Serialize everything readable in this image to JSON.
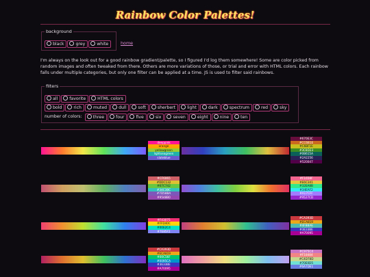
{
  "title": "Rainbow Color Palettes!",
  "background": {
    "legend": "background",
    "options": [
      "black",
      "grey",
      "white"
    ]
  },
  "home_link": "home",
  "intro": "I'm always on the look out for a good rainbow gradient/palette, so I figured I'd log them somewhere! Some are color picked from random images and often tweaked from there. Others are more variations of those, or trial and error with HTML colors. Each rainbow falls under multiple categories, but only one filter can be applied at a time. JS is used to filter said rainbows.",
  "filters": {
    "legend": "filters",
    "row1": [
      "all",
      "favorite",
      "HTML colors"
    ],
    "row2": [
      "bold",
      "rich",
      "muted",
      "dull",
      "soft",
      "sherbert",
      "light",
      "dark",
      "spectrum",
      "red",
      "sky"
    ],
    "num_label": "number of colors:",
    "row3": [
      "three",
      "four",
      "five",
      "six",
      "seven",
      "eight",
      "nine",
      "ten"
    ]
  },
  "palettes": [
    {
      "left_colors": [
        "#ff1493",
        "#ff7a2e",
        "#f2e84a",
        "#5fe35a",
        "#3fa9f5",
        "#7b5cff"
      ],
      "right_colors": [
        "#6b2fa0",
        "#3040c0",
        "#2aa0c0",
        "#40c060",
        "#e0c040",
        "#c02830"
      ],
      "mid": [
        {
          "label": "deeppink",
          "color": "#ff1493"
        },
        {
          "label": "orange",
          "color": "#ffa500",
          "dark": true
        },
        {
          "label": "yellowgreen",
          "color": "#9acd32",
          "dark": true
        },
        {
          "label": "lightseagreen",
          "color": "#20b2aa"
        },
        {
          "label": "slateblue",
          "color": "#6a5acd"
        }
      ],
      "right": [
        {
          "label": "#670E3C",
          "color": "#670e3c"
        },
        {
          "label": "#CC6B1E",
          "color": "#cc6b1e"
        },
        {
          "label": "#C6BF1E",
          "color": "#c6bf1e",
          "dark": true
        },
        {
          "label": "#3C8D23",
          "color": "#3c8d23"
        },
        {
          "label": "#0B615A",
          "color": "#0b615a"
        },
        {
          "label": "#2A2256",
          "color": "#2a2256"
        },
        {
          "label": "#520047",
          "color": "#520047"
        }
      ]
    },
    {
      "left_colors": [
        "#c05070",
        "#d0a060",
        "#c0c070",
        "#60b060",
        "#5080c0",
        "#8060b0"
      ],
      "right_colors": [
        "#9050d0",
        "#5080e0",
        "#40c0a0",
        "#80d040",
        "#e0e040",
        "#f07030",
        "#e03060"
      ],
      "mid": [
        {
          "label": "#CF6065",
          "color": "#cf6065"
        },
        {
          "label": "#DDC132",
          "color": "#ddc132",
          "dark": true
        },
        {
          "label": "#67C742",
          "color": "#67c742",
          "dark": true
        },
        {
          "label": "#34C3BC",
          "color": "#34c3bc"
        },
        {
          "label": "#7D58BA",
          "color": "#7d58ba"
        },
        {
          "label": "#9548B0",
          "color": "#9548b0"
        }
      ],
      "right": [
        {
          "label": "#F1658F",
          "color": "#f1658f"
        },
        {
          "label": "#E6C341",
          "color": "#e6c341",
          "dark": true
        },
        {
          "label": "#32EA8B",
          "color": "#32ea8b",
          "dark": true
        },
        {
          "label": "#34EAF2",
          "color": "#34eaf2",
          "dark": true
        },
        {
          "label": "#A17CFF",
          "color": "#a17cff"
        },
        {
          "label": "#9527CD",
          "color": "#9527cd"
        }
      ]
    },
    {
      "left_colors": [
        "#f04070",
        "#f09030",
        "#c0e030",
        "#40e0a0",
        "#3080f0",
        "#8040e0"
      ],
      "right_colors": [
        "#c04080",
        "#e08030",
        "#d0c030",
        "#30c090",
        "#4060c0",
        "#8030a0"
      ],
      "mid": [
        {
          "label": "#F43075",
          "color": "#f43075"
        },
        {
          "label": "#FFD40C",
          "color": "#ffd40c",
          "dark": true
        },
        {
          "label": "#00E2C4",
          "color": "#00e2c4",
          "dark": true
        },
        {
          "label": "#7E85F2",
          "color": "#7e85f2"
        }
      ],
      "right": [
        {
          "label": "#CA393D",
          "color": "#ca393d"
        },
        {
          "label": "#ECA819",
          "color": "#eca819",
          "dark": true
        },
        {
          "label": "#4FBBAE",
          "color": "#4fbbae"
        },
        {
          "label": "#3E33BE",
          "color": "#3e33be"
        },
        {
          "label": "#A70095",
          "color": "#a70095"
        }
      ]
    },
    {
      "left_colors": [
        "#b02060",
        "#e07030",
        "#e0c030",
        "#40c060",
        "#3070d0",
        "#8030c0"
      ],
      "right_colors": [
        "#e070c0",
        "#f0a0a0",
        "#f0e080",
        "#a0f0a0",
        "#80c0f0",
        "#c0a0f0"
      ],
      "mid": [
        {
          "label": "#CA393D",
          "color": "#ca393d"
        },
        {
          "label": "#ECA819",
          "color": "#eca819",
          "dark": true
        },
        {
          "label": "#00C56F",
          "color": "#00c56f"
        },
        {
          "label": "#0095CA",
          "color": "#0095ca"
        },
        {
          "label": "#3E33BE",
          "color": "#3e33be"
        },
        {
          "label": "#A70095",
          "color": "#a70095"
        }
      ],
      "right": [
        {
          "label": "#C975C4",
          "color": "#c975c4"
        },
        {
          "label": "#F18484",
          "color": "#f18484"
        },
        {
          "label": "#C4D78D",
          "color": "#c4d78d",
          "dark": true
        },
        {
          "label": "#70E0D5",
          "color": "#70e0d5",
          "dark": true
        },
        {
          "label": "#6A7DE1",
          "color": "#6a7de1"
        }
      ]
    }
  ]
}
